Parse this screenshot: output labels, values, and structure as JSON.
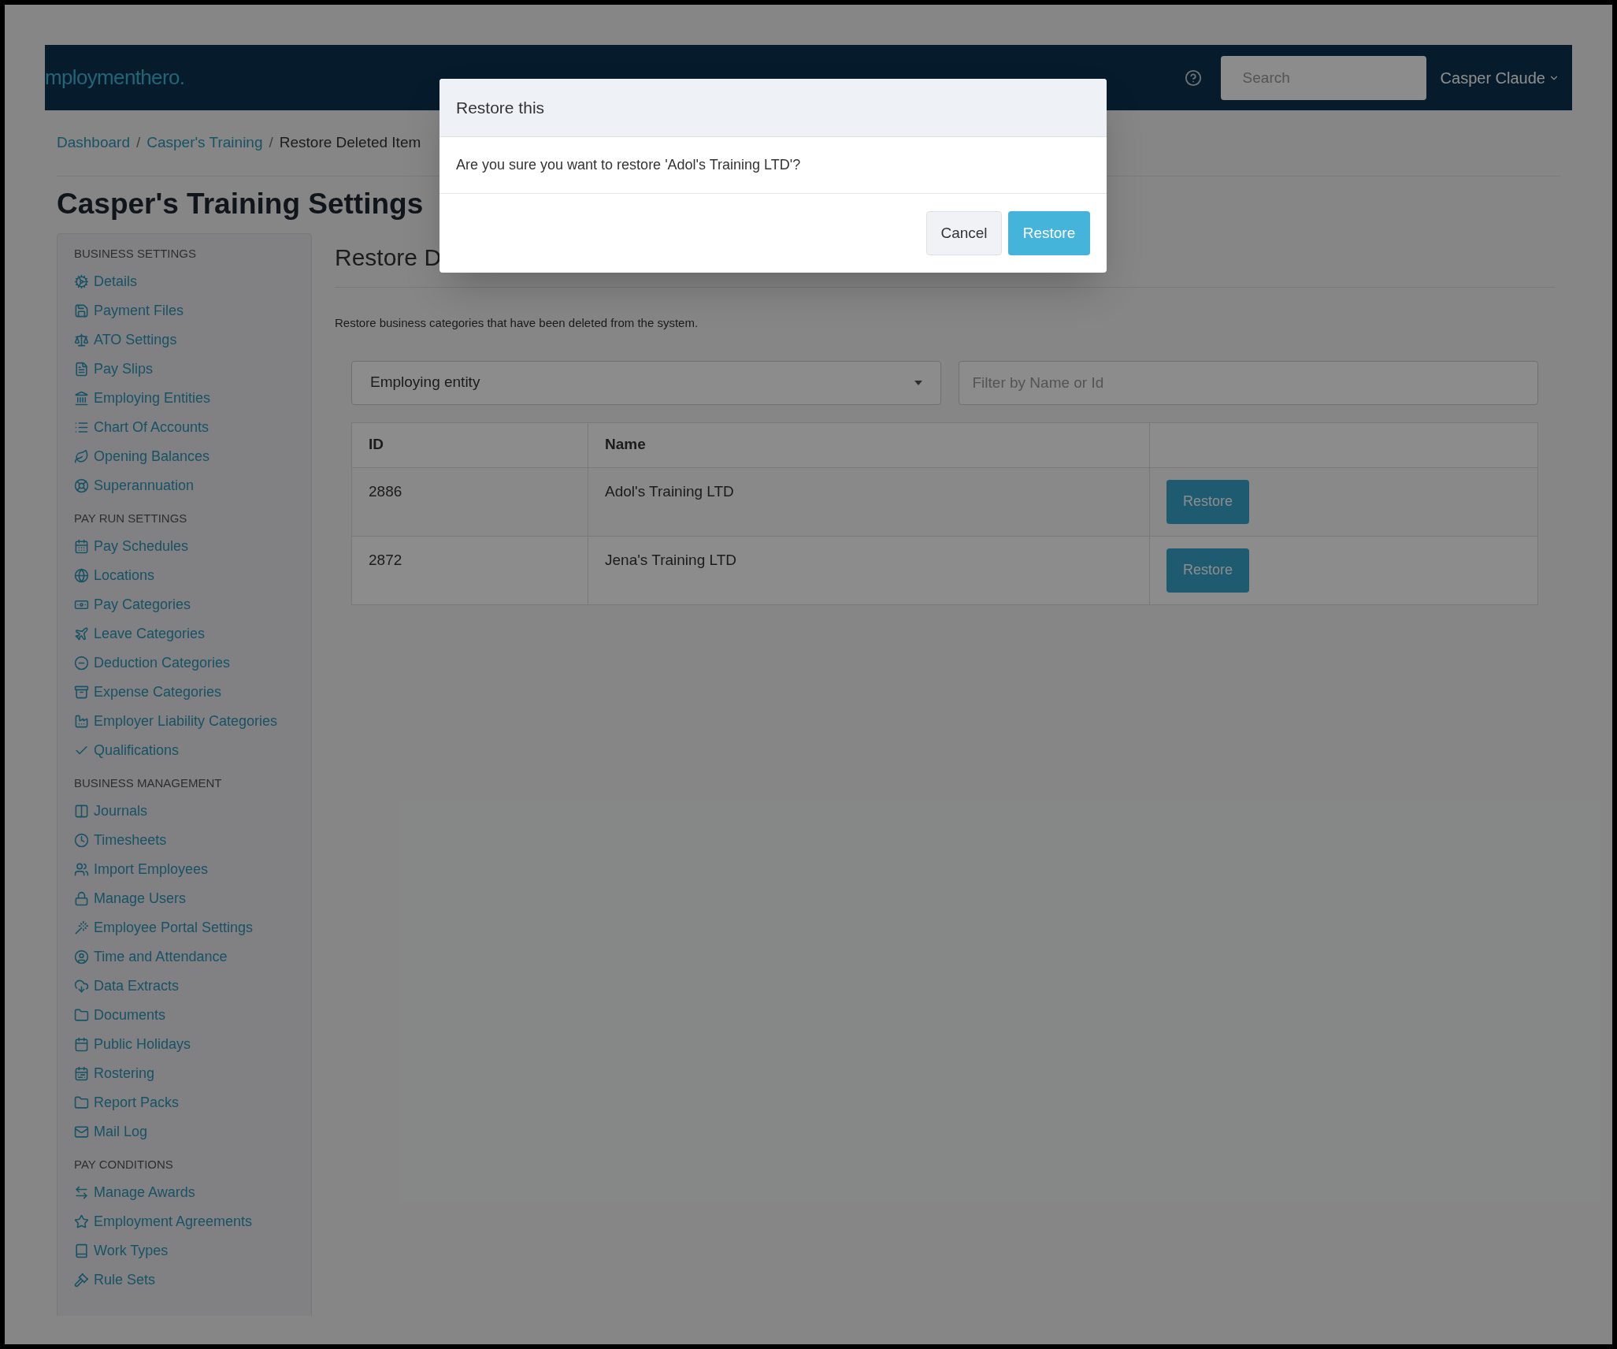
{
  "navbar": {
    "logo": "mploymenthero.",
    "search": {
      "placeholder": "Search"
    },
    "user": "Casper Claude"
  },
  "breadcrumb": [
    {
      "label": "Dashboard",
      "kind": "link",
      "separator": "/"
    },
    {
      "label": "Casper's Training",
      "kind": "link",
      "separator": "/"
    },
    {
      "label": "Restore Deleted Item",
      "kind": "current"
    }
  ],
  "page_title": "Casper's Training Settings",
  "sidebar": {
    "sections": [
      {
        "title": "BUSINESS SETTINGS",
        "items": [
          "Details",
          "Payment Files",
          "ATO Settings",
          "Pay Slips",
          "Employing Entities",
          "Chart Of Accounts",
          "Opening Balances",
          "Superannuation"
        ]
      },
      {
        "title": "PAY RUN SETTINGS",
        "items": [
          "Pay Schedules",
          "Locations",
          "Pay Categories",
          "Leave Categories",
          "Deduction Categories",
          "Expense Categories",
          "Employer Liability Categories",
          "Qualifications"
        ]
      },
      {
        "title": "BUSINESS MANAGEMENT",
        "items": [
          "Journals",
          "Timesheets",
          "Import Employees",
          "Manage Users",
          "Employee Portal Settings",
          "Time and Attendance",
          "Data Extracts",
          "Documents",
          "Public Holidays",
          "Rostering",
          "Report Packs",
          "Mail Log"
        ]
      },
      {
        "title": "PAY CONDITIONS",
        "items": [
          "Manage Awards",
          "Employment Agreements",
          "Work Types",
          "Rule Sets"
        ]
      }
    ]
  },
  "content": {
    "heading": "Restore D",
    "description": "Restore business categories that have been deleted from the system.",
    "filters": {
      "select_value": "Employing entity",
      "search_placeholder": "Filter by Name or Id"
    },
    "table": {
      "columns": [
        "ID",
        "Name"
      ],
      "rows": [
        {
          "id": "2886",
          "name": "Adol's Training LTD",
          "action": "Restore"
        },
        {
          "id": "2872",
          "name": "Jena's Training LTD",
          "action": "Restore"
        }
      ]
    }
  },
  "modal": {
    "title": "Restore this",
    "message": "Are you sure you want to restore 'Adol's Training LTD'?",
    "buttons": [
      {
        "label": "Cancel",
        "kind": "secondary"
      },
      {
        "label": "Restore",
        "kind": "primary"
      }
    ]
  }
}
